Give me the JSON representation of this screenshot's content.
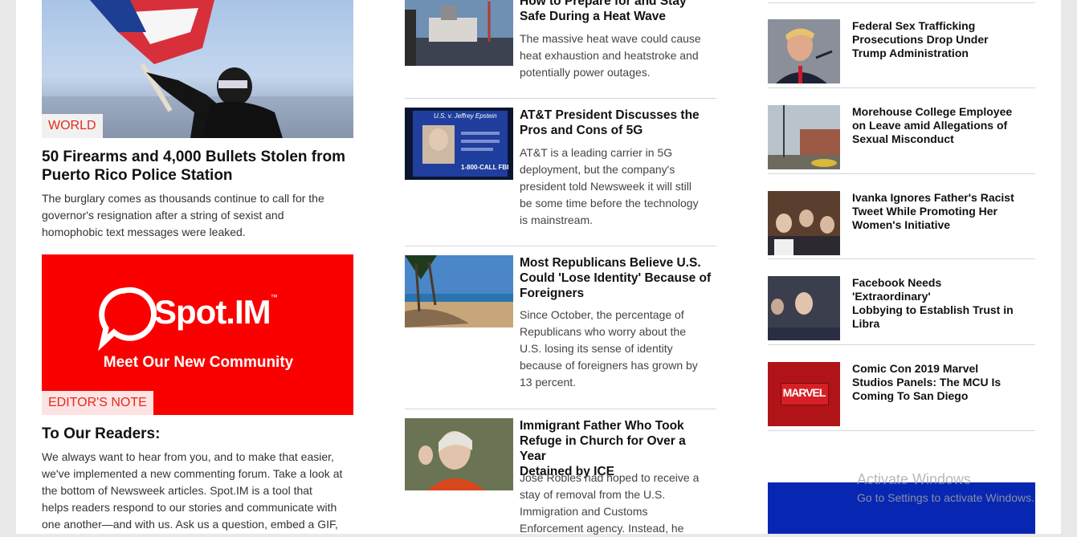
{
  "left": {
    "feature": {
      "tag": "WORLD",
      "title_line1": "50 Firearms and 4,000 Bullets Stolen from",
      "title_line2": "Puerto Rico Police Station",
      "desc_lines": [
        "The burglary comes as thousands continue to call for the",
        "governor's resignation after a string of sexist and",
        "homophobic text messages were leaked."
      ]
    },
    "promo": {
      "brand": "Spot.IM",
      "tm": "™",
      "tagline": "Meet Our New Community",
      "tag": "EDITOR'S NOTE",
      "title": "To Our Readers:",
      "desc_lines": [
        "We always want to hear from you, and to make that easier,",
        "we've implemented a new commenting forum. Take a look at",
        "the bottom of Newsweek articles. Spot.IM is a tool that",
        "helps readers respond to our stories and communicate with",
        "one another—and with us. Ask us a question, embed a GIF,"
      ]
    }
  },
  "middle": {
    "items": [
      {
        "title_lines": [
          "How to Prepare for and Stay",
          "Safe During a Heat Wave"
        ],
        "desc_lines": [
          "The massive heat wave could cause",
          "heat exhaustion and heatstroke and",
          "potentially power outages."
        ]
      },
      {
        "title_lines": [
          "AT&T President Discusses the",
          "Pros and Cons of 5G"
        ],
        "desc_lines": [
          "AT&T is a leading carrier in 5G",
          "deployment, but the company's",
          "president told Newsweek it will still",
          "be some time before the technology",
          "is mainstream."
        ],
        "thumb_text_top": "U.S. v. Jeffrey Epstein",
        "thumb_text_bottom": "1-800-CALL FBI"
      },
      {
        "title_lines": [
          "Most Republicans Believe U.S.",
          "Could 'Lose Identity' Because of",
          "Foreigners"
        ],
        "desc_lines": [
          "Since October, the percentage of",
          "Republicans who worry about the",
          "U.S. losing its sense of identity",
          "because of foreigners has grown by",
          "13 percent."
        ]
      },
      {
        "title_lines": [
          "Immigrant Father Who Took",
          "Refuge in Church for Over a Year",
          "Detained by ICE"
        ],
        "desc_lines": [
          "Jose Robles had hoped to receive a",
          "stay of removal from the U.S.",
          "Immigration and Customs",
          "Enforcement agency. Instead, he"
        ]
      }
    ]
  },
  "right": {
    "items": [
      {
        "title_lines": [
          "Federal Sex Trafficking",
          "Prosecutions Drop Under",
          "Trump Administration"
        ]
      },
      {
        "title_lines": [
          "Morehouse College Employee",
          "on Leave amid Allegations of",
          "Sexual Misconduct"
        ]
      },
      {
        "title_lines": [
          "Ivanka Ignores Father's Racist",
          "Tweet While Promoting Her",
          "Women's Initiative"
        ]
      },
      {
        "title_lines": [
          "Facebook Needs 'Extraordinary'",
          "Lobbying to Establish Trust in",
          "Libra"
        ]
      },
      {
        "title_lines": [
          "Comic Con 2019 Marvel",
          "Studios Panels: The MCU Is",
          "Coming To San Diego"
        ],
        "thumb_text": "MARVEL"
      }
    ]
  },
  "overlay": {
    "activate_title": "Activate Windows",
    "activate_sub": "Go to Settings to activate Windows."
  },
  "colors": {
    "accent": "#e32b1c",
    "promo_bg": "#fa0000",
    "ad_bg": "#0727b3"
  }
}
